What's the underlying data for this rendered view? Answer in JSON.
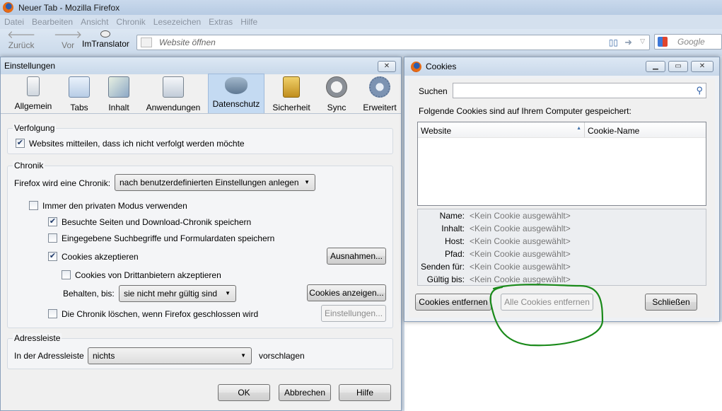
{
  "browser": {
    "title": "Neuer Tab - Mozilla Firefox",
    "menu": [
      "Datei",
      "Bearbeiten",
      "Ansicht",
      "Chronik",
      "Lesezeichen",
      "Extras",
      "Hilfe"
    ],
    "back_label": "Zurück",
    "forward_label": "Vor",
    "imtranslator_label": "ImTranslator",
    "url_placeholder": "Website öffnen",
    "search_engine": "Google"
  },
  "settings": {
    "title": "Einstellungen",
    "close": "✕",
    "categories": [
      "Allgemein",
      "Tabs",
      "Inhalt",
      "Anwendungen",
      "Datenschutz",
      "Sicherheit",
      "Sync",
      "Erweitert"
    ],
    "selected_category": "Datenschutz",
    "tracking": {
      "legend": "Verfolgung",
      "dnt_label": "Websites mitteilen, dass ich nicht verfolgt werden möchte",
      "dnt_checked": true
    },
    "history": {
      "legend": "Chronik",
      "mode_label": "Firefox wird eine Chronik:",
      "mode_value": "nach benutzerdefinierten Einstellungen anlegen",
      "private_label": "Immer den privaten Modus verwenden",
      "visited_label": "Besuchte Seiten und Download-Chronik speichern",
      "search_label": "Eingegebene Suchbegriffe und Formulardaten speichern",
      "cookies_label": "Cookies akzeptieren",
      "exceptions_button": "Ausnahmen...",
      "third_party_label": "Cookies von Drittanbietern akzeptieren",
      "keep_label": "Behalten, bis:",
      "keep_value": "sie nicht mehr gültig sind",
      "show_cookies_button": "Cookies anzeigen...",
      "clear_label": "Die Chronik löschen, wenn Firefox geschlossen wird",
      "clear_settings_button": "Einstellungen..."
    },
    "locationbar": {
      "legend": "Adressleiste",
      "label": "In der Adressleiste",
      "value": "nichts",
      "suffix": "vorschlagen"
    },
    "ok": "OK",
    "cancel": "Abbrechen",
    "help": "Hilfe"
  },
  "cookies": {
    "title": "Cookies",
    "search_label": "Suchen",
    "intro": "Folgende Cookies sind auf Ihrem Computer gespeichert:",
    "col_website": "Website",
    "col_cookie_name": "Cookie-Name",
    "details": [
      {
        "label": "Name:",
        "value": "<Kein Cookie ausgewählt>"
      },
      {
        "label": "Inhalt:",
        "value": "<Kein Cookie ausgewählt>"
      },
      {
        "label": "Host:",
        "value": "<Kein Cookie ausgewählt>"
      },
      {
        "label": "Pfad:",
        "value": "<Kein Cookie ausgewählt>"
      },
      {
        "label": "Senden für:",
        "value": "<Kein Cookie ausgewählt>"
      },
      {
        "label": "Gültig bis:",
        "value": "<Kein Cookie ausgewählt>"
      }
    ],
    "remove_button": "Cookies entfernen",
    "remove_all_button": "Alle Cookies entfernen",
    "close_button": "Schließen"
  },
  "colors": {
    "annotation": "#1a8a1a",
    "selected_tab": "#c4daf2"
  }
}
